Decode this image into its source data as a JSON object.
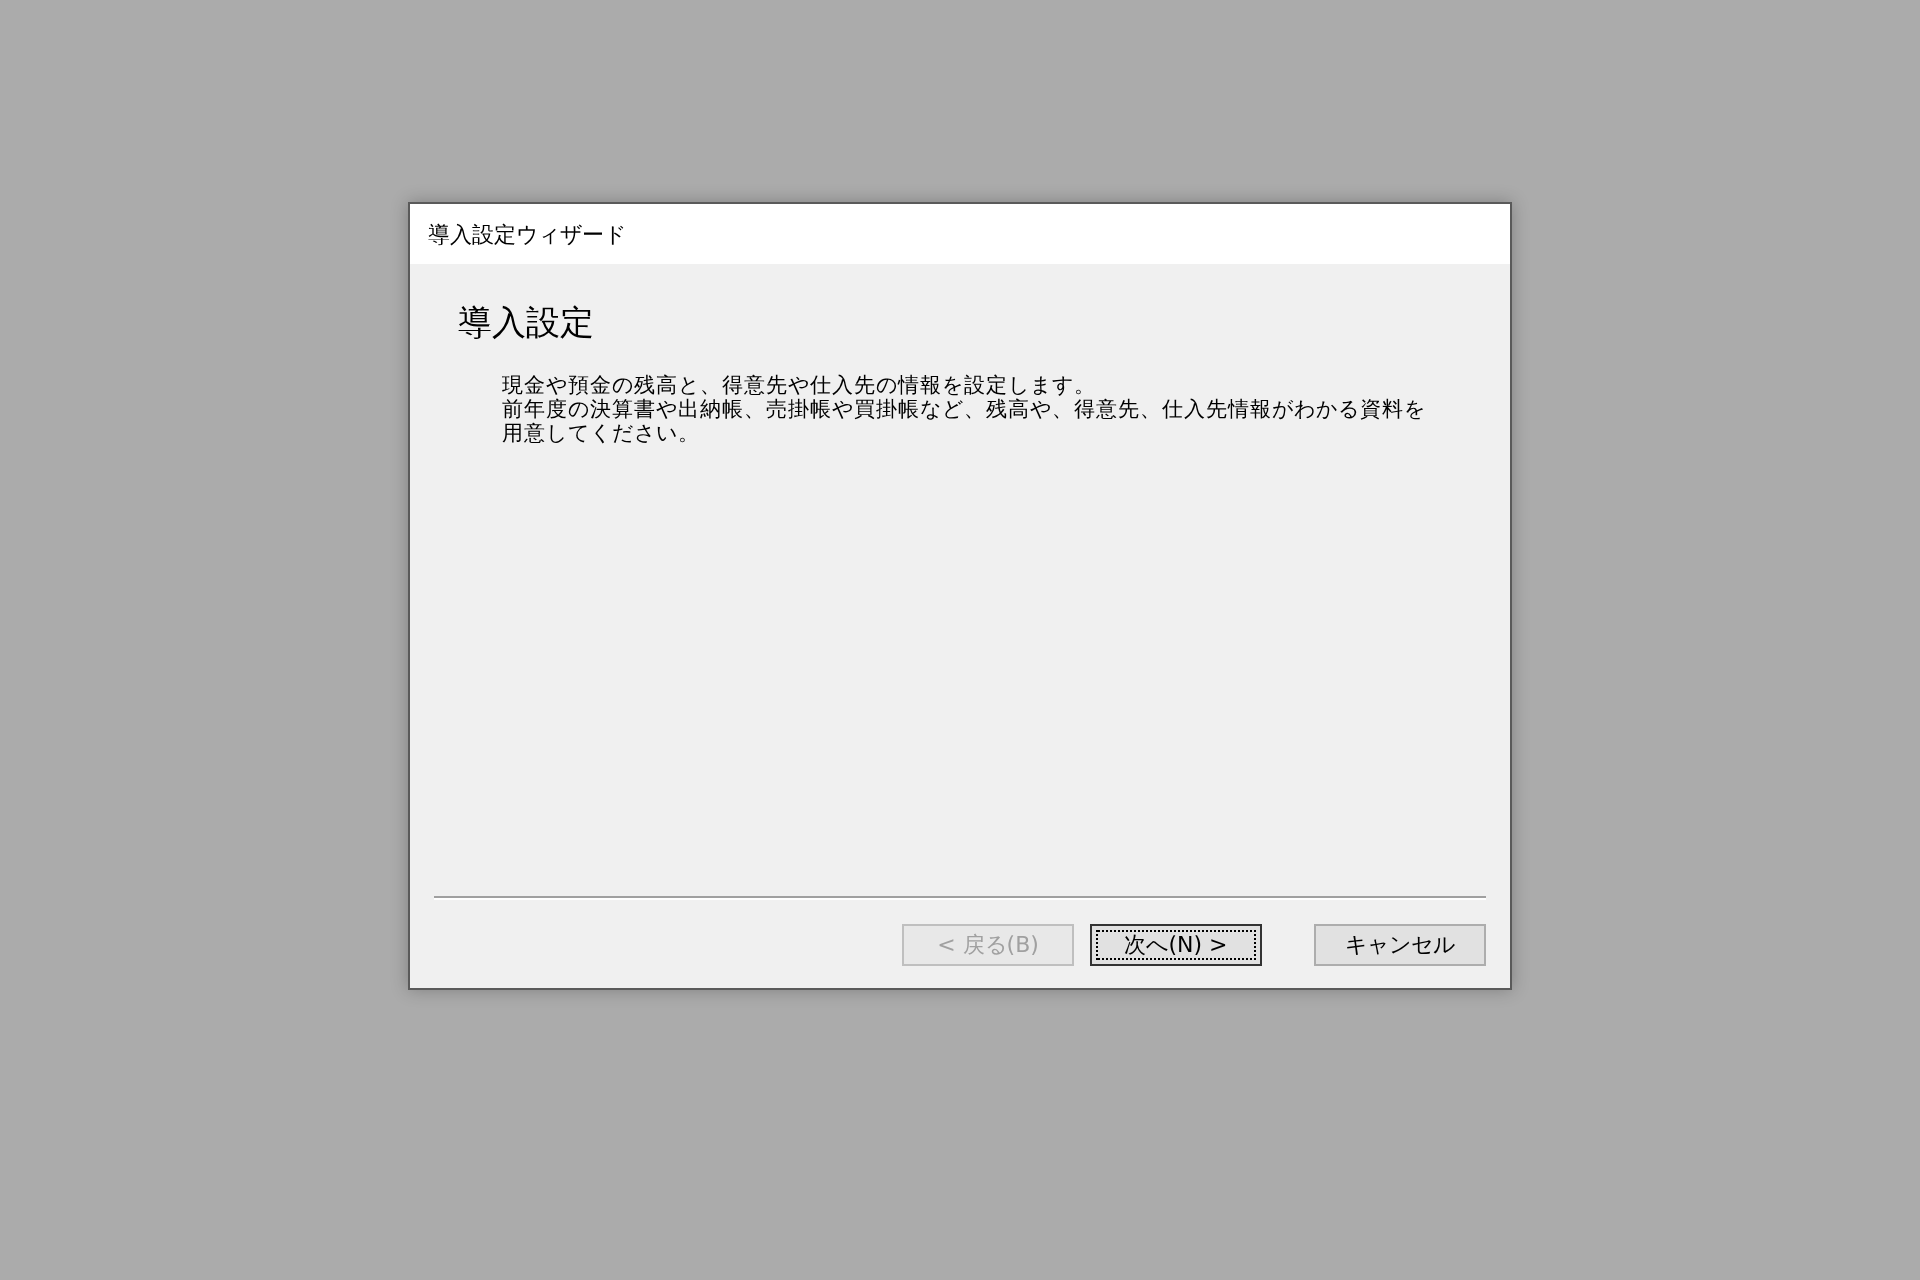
{
  "window": {
    "title": "導入設定ウィザード"
  },
  "heading": "導入設定",
  "description_lines": [
    "現金や預金の残高と、得意先や仕入先の情報を設定します。",
    "前年度の決算書や出納帳、売掛帳や買掛帳など、残高や、得意先、仕入先情報がわかる資料を",
    "用意してください。"
  ],
  "buttons": [
    {
      "label": "< 戻る(B)",
      "disabled": true,
      "focused": false
    },
    {
      "label": "次へ(N) >",
      "disabled": false,
      "focused": true
    },
    {
      "label": "キャンセル",
      "disabled": false,
      "focused": false
    }
  ]
}
